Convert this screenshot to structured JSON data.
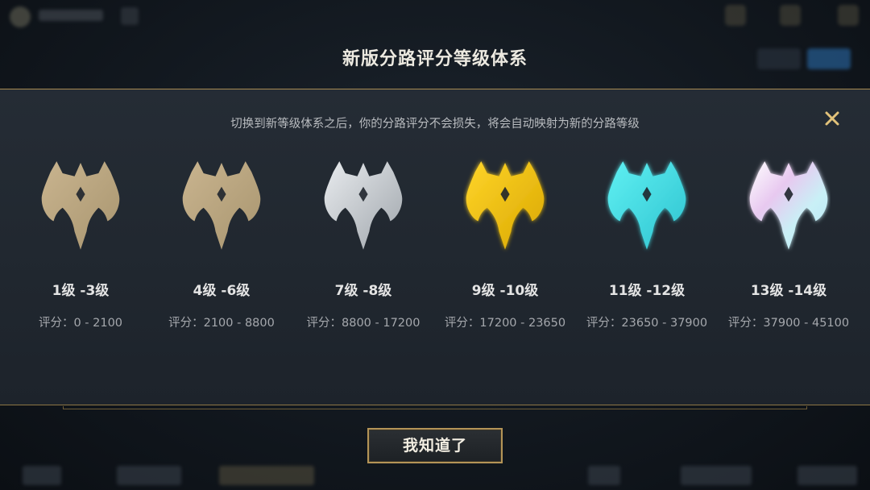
{
  "dialog": {
    "title": "新版分路评分等级体系",
    "subtitle": "切换到新等级体系之后，你的分路评分不会损失，将会自动映射为新的分路等级",
    "confirm_label": "我知道了",
    "close_icon": "close-icon"
  },
  "tiers": [
    {
      "level": "1级 -3级",
      "score": "评分：0 - 2100",
      "icon": "beige-rank-emblem-icon",
      "color": "#c9b48f",
      "shade": "#a8956f"
    },
    {
      "level": "4级 -6级",
      "score": "评分：2100 - 8800",
      "icon": "beige-rank-emblem-icon",
      "color": "#c9b48f",
      "shade": "#a8956f"
    },
    {
      "level": "7级 -8级",
      "score": "评分：8800 - 17200",
      "icon": "silver-rank-emblem-icon",
      "color": "#e8ebee",
      "shade": "#9fa5ab"
    },
    {
      "level": "9级 -10级",
      "score": "评分：17200 - 23650",
      "icon": "gold-rank-emblem-icon",
      "color": "#ffd52a",
      "shade": "#d9a700"
    },
    {
      "level": "11级 -12级",
      "score": "评分：23650 - 37900",
      "icon": "cyan-rank-emblem-icon",
      "color": "#5ff0f2",
      "shade": "#2ec3d0"
    },
    {
      "level": "13级 -14级",
      "score": "评分：37900 - 45100",
      "icon": "iridescent-rank-emblem-icon",
      "color": "#e8f6fb",
      "shade": "#bfe3f2"
    }
  ],
  "colors": {
    "accent_gold": "#b49457",
    "panel_bg": "#222931"
  }
}
